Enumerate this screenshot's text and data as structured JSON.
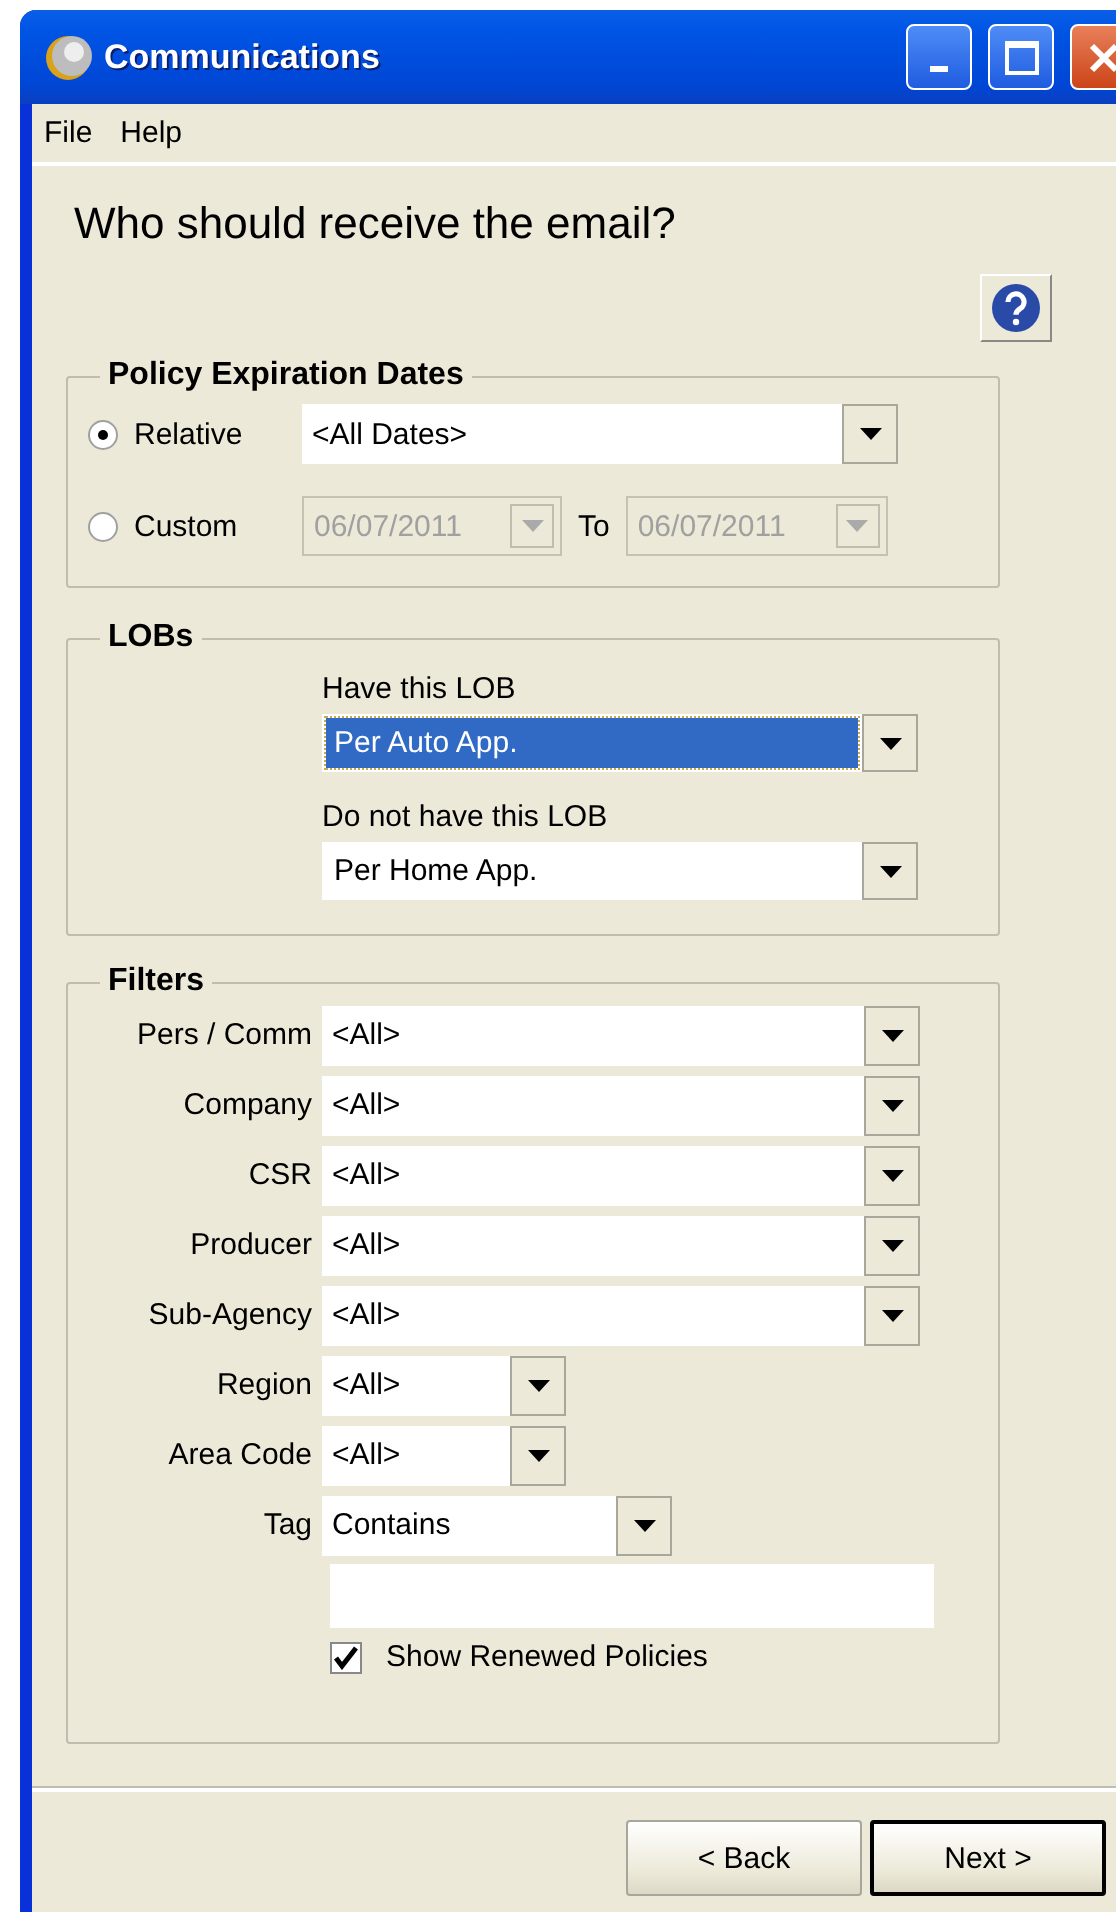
{
  "window": {
    "title": "Communications"
  },
  "menu": [
    {
      "label": "File"
    },
    {
      "label": "Help"
    }
  ],
  "heading": "Who should receive the email?",
  "policy_expiration_dates": {
    "title": "Policy Expiration Dates",
    "options": [
      {
        "kind": "relative",
        "label": "Relative",
        "selected": true,
        "value": "<All Dates>"
      },
      {
        "kind": "range",
        "label": "Custom",
        "selected": false,
        "from": "06/07/2011",
        "to_label": "To",
        "to": "06/07/2011"
      }
    ]
  },
  "lobs": {
    "title": "LOBs",
    "fields": [
      {
        "label": "Have this LOB",
        "value": "Per Auto App.",
        "focused": true
      },
      {
        "label": "Do not have this LOB",
        "value": "Per Home App.",
        "focused": false
      }
    ]
  },
  "filters": {
    "title": "Filters",
    "rows": [
      {
        "label": "Pers / Comm",
        "value": "<All>",
        "kind": "wide"
      },
      {
        "label": "Company",
        "value": "<All>",
        "kind": "wide"
      },
      {
        "label": "CSR",
        "value": "<All>",
        "kind": "wide"
      },
      {
        "label": "Producer",
        "value": "<All>",
        "kind": "wide"
      },
      {
        "label": "Sub-Agency",
        "value": "<All>",
        "kind": "wide"
      },
      {
        "label": "Region",
        "value": "<All>",
        "kind": "narrow"
      },
      {
        "label": "Area Code",
        "value": "<All>",
        "kind": "narrow"
      },
      {
        "label": "Tag",
        "value": "Contains",
        "kind": "medium"
      }
    ],
    "show_renewed": {
      "label": "Show Renewed Policies",
      "checked": true
    }
  },
  "buttons": [
    {
      "label": "< Back",
      "default": false
    },
    {
      "label": "Next >",
      "default": true
    }
  ]
}
